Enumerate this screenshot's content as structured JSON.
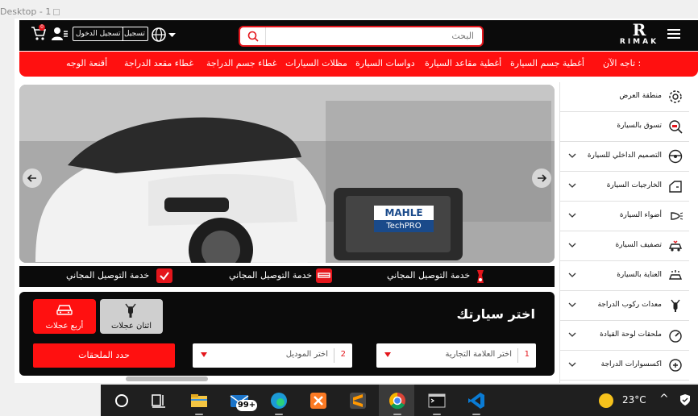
{
  "window": {
    "frame_label": "Desktop - 1"
  },
  "header": {
    "logo_text": "RIMAK",
    "logo_mark": "R",
    "search_placeholder": "البحث",
    "register_label": "تسجيل",
    "login_label": "تسجيل الدخول",
    "cart_count": "0"
  },
  "nav": {
    "lead": "تاجه الآن :",
    "items": [
      "أغطية جسم السيارة",
      "أغطية مقاعد السيارة",
      "دواسات السيارة",
      "مظلات السيارات",
      "غطاء جسم الدراجة",
      "غطاء مقعد الدراجة",
      "أقنعة الوجه"
    ]
  },
  "sidebar": {
    "items": [
      {
        "label": "منطقة العرض",
        "icon": "gear-icon",
        "has_chevron": false
      },
      {
        "label": "تسوق بالسيارة",
        "icon": "car-search-icon",
        "has_chevron": false
      },
      {
        "label": "التصميم الداخلي للسيارة",
        "icon": "steering-wheel-icon",
        "has_chevron": true
      },
      {
        "label": "الخارجيات السيارة",
        "icon": "car-door-icon",
        "has_chevron": true
      },
      {
        "label": "أضواء السيارة",
        "icon": "headlight-icon",
        "has_chevron": true
      },
      {
        "label": "تصفيف السيارة",
        "icon": "car-style-icon",
        "has_chevron": true
      },
      {
        "label": "العناية بالسيارة",
        "icon": "car-wash-icon",
        "has_chevron": true
      },
      {
        "label": "معدات ركوب الدراجة",
        "icon": "bike-gear-icon",
        "has_chevron": true
      },
      {
        "label": "ملحقات لوحة القيادة",
        "icon": "dashboard-icon",
        "has_chevron": true
      },
      {
        "label": "اكسسوارات الدراجة",
        "icon": "bike-accessory-icon",
        "has_chevron": true
      }
    ]
  },
  "hero": {
    "prev_icon": "arrow-left-icon",
    "next_icon": "arrow-right-icon",
    "brand_top": "MAHLE",
    "brand_bottom": "TechPRO",
    "slide_count": 4,
    "active_slide": 2
  },
  "features": [
    {
      "label": "خدمة التوصيل المجاني",
      "icon": "motorbike-icon"
    },
    {
      "label": "خدمة التوصيل المجاني",
      "icon": "card-icon"
    },
    {
      "label": "خدمة التوصيل المجاني",
      "icon": "check-icon"
    }
  ],
  "selector": {
    "title": "اختر سيارتك",
    "four_wheels": "أربع عجلات",
    "two_wheels": "اثنان عجلات",
    "brand_num": "1",
    "brand_label": "اختر العلامة التجارية",
    "model_num": "2",
    "model_label": "اختر الموديل",
    "submit_label": "حدد الملحقات"
  },
  "taskbar": {
    "mail_badge": "99+",
    "temperature": "23°C",
    "colors": {
      "chrome_red": "#db4437",
      "vscode_blue": "#0a7bd4"
    }
  },
  "colors": {
    "brand_red": "#ff1010",
    "header_black": "#0b0b0b"
  }
}
